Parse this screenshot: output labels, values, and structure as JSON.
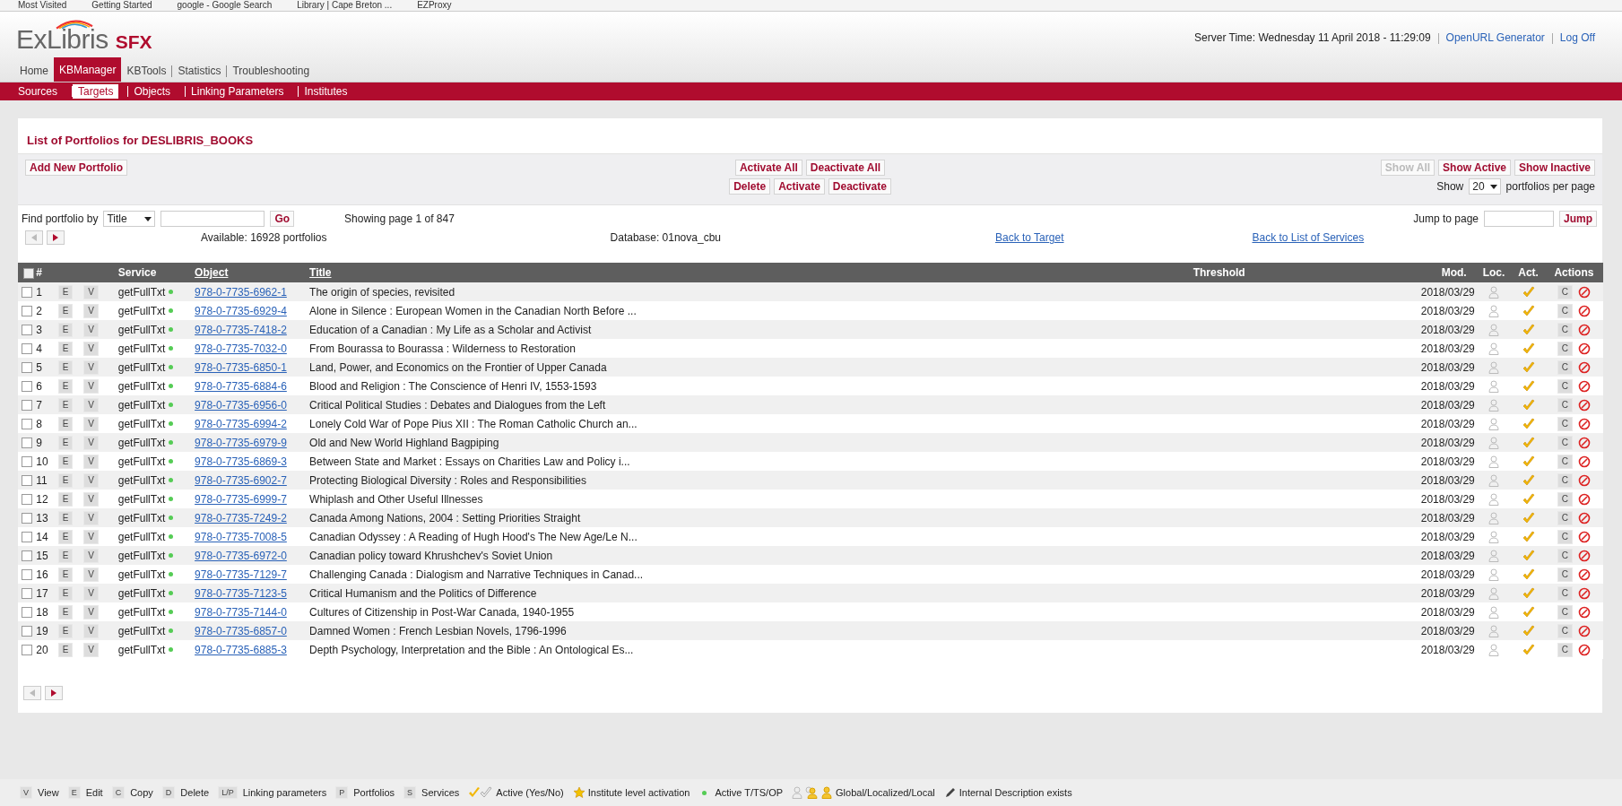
{
  "bookmarks": [
    "Most Visited",
    "Getting Started",
    "google - Google Search",
    "Library | Cape Breton ...",
    "EZProxy"
  ],
  "header": {
    "logo_main": "ExLibris",
    "logo_sub": "SFX",
    "server_time": "Server Time: Wednesday 11 April 2018 - 11:29:09",
    "links": [
      "OpenURL Generator",
      "Log Off"
    ]
  },
  "nav": [
    {
      "label": "Home",
      "selected": false
    },
    {
      "label": "KBManager",
      "selected": true
    },
    {
      "label": "KBTools",
      "selected": false
    },
    {
      "label": "Statistics",
      "selected": false
    },
    {
      "label": "Troubleshooting",
      "selected": false
    }
  ],
  "subnav": [
    {
      "label": "Sources",
      "selected": false
    },
    {
      "label": "Targets",
      "selected": true
    },
    {
      "label": "Objects",
      "selected": false
    },
    {
      "label": "Linking Parameters",
      "selected": false
    },
    {
      "label": "Institutes",
      "selected": false
    }
  ],
  "page_title": "List of Portfolios for DESLIBRIS_BOOKS",
  "toolbar": {
    "add": "Add New Portfolio",
    "center_top": [
      "Activate All",
      "Deactivate All"
    ],
    "center_bottom": [
      "Delete",
      "Activate",
      "Deactivate"
    ],
    "filters": [
      {
        "label": "Show All",
        "disabled": true
      },
      {
        "label": "Show Active",
        "disabled": false
      },
      {
        "label": "Show Inactive",
        "disabled": false
      }
    ],
    "show_label": "Show",
    "per_page": "20",
    "per_page_suffix": "portfolios per page"
  },
  "find": {
    "label": "Find portfolio by",
    "field": "Title",
    "button": "Go",
    "showing": "Showing page 1 of 847",
    "jump_label": "Jump to page",
    "jump_button": "Jump",
    "available": "Available: 16928 portfolios",
    "database": "Database: 01nova_cbu",
    "back_target": "Back to Target",
    "back_services": "Back to List of Services"
  },
  "table": {
    "columns": [
      "#",
      "Service",
      "Object",
      "Title",
      "Threshold",
      "Mod.",
      "Loc.",
      "Act.",
      "Actions"
    ],
    "select_all_checked": false,
    "rows": [
      {
        "num": "1",
        "service": "getFullTxt",
        "object": "978-0-7735-6962-1",
        "title": "The origin of species, revisited",
        "mod": "2018/03/29",
        "checked": false,
        "edit": "E",
        "view": "V",
        "copy": "C"
      },
      {
        "num": "2",
        "service": "getFullTxt",
        "object": "978-0-7735-6929-4",
        "title": "Alone in Silence : European Women in the Canadian North Before ...",
        "mod": "2018/03/29",
        "checked": false,
        "edit": "E",
        "view": "V",
        "copy": "C"
      },
      {
        "num": "3",
        "service": "getFullTxt",
        "object": "978-0-7735-7418-2",
        "title": "Education of a Canadian : My Life as a Scholar and Activist",
        "mod": "2018/03/29",
        "checked": false,
        "edit": "E",
        "view": "V",
        "copy": "C"
      },
      {
        "num": "4",
        "service": "getFullTxt",
        "object": "978-0-7735-7032-0",
        "title": "From Bourassa to Bourassa : Wilderness to Restoration",
        "mod": "2018/03/29",
        "checked": false,
        "edit": "E",
        "view": "V",
        "copy": "C"
      },
      {
        "num": "5",
        "service": "getFullTxt",
        "object": "978-0-7735-6850-1",
        "title": "Land, Power, and Economics on the Frontier of Upper Canada",
        "mod": "2018/03/29",
        "checked": false,
        "edit": "E",
        "view": "V",
        "copy": "C"
      },
      {
        "num": "6",
        "service": "getFullTxt",
        "object": "978-0-7735-6884-6",
        "title": "Blood and Religion : The Conscience of Henri IV, 1553-1593",
        "mod": "2018/03/29",
        "checked": false,
        "edit": "E",
        "view": "V",
        "copy": "C"
      },
      {
        "num": "7",
        "service": "getFullTxt",
        "object": "978-0-7735-6956-0",
        "title": "Critical Political Studies : Debates and Dialogues from the Left",
        "mod": "2018/03/29",
        "checked": false,
        "edit": "E",
        "view": "V",
        "copy": "C"
      },
      {
        "num": "8",
        "service": "getFullTxt",
        "object": "978-0-7735-6994-2",
        "title": "Lonely Cold War of Pope Pius XII : The Roman Catholic Church an...",
        "mod": "2018/03/29",
        "checked": false,
        "edit": "E",
        "view": "V",
        "copy": "C"
      },
      {
        "num": "9",
        "service": "getFullTxt",
        "object": "978-0-7735-6979-9",
        "title": "Old and New World Highland Bagpiping",
        "mod": "2018/03/29",
        "checked": false,
        "edit": "E",
        "view": "V",
        "copy": "C"
      },
      {
        "num": "10",
        "service": "getFullTxt",
        "object": "978-0-7735-6869-3",
        "title": "Between State and Market : Essays on Charities Law and Policy i...",
        "mod": "2018/03/29",
        "checked": false,
        "edit": "E",
        "view": "V",
        "copy": "C"
      },
      {
        "num": "11",
        "service": "getFullTxt",
        "object": "978-0-7735-6902-7",
        "title": "Protecting Biological Diversity : Roles and Responsibilities",
        "mod": "2018/03/29",
        "checked": false,
        "edit": "E",
        "view": "V",
        "copy": "C"
      },
      {
        "num": "12",
        "service": "getFullTxt",
        "object": "978-0-7735-6999-7",
        "title": "Whiplash and Other Useful Illnesses",
        "mod": "2018/03/29",
        "checked": false,
        "edit": "E",
        "view": "V",
        "copy": "C"
      },
      {
        "num": "13",
        "service": "getFullTxt",
        "object": "978-0-7735-7249-2",
        "title": "Canada Among Nations, 2004 : Setting Priorities Straight",
        "mod": "2018/03/29",
        "checked": false,
        "edit": "E",
        "view": "V",
        "copy": "C"
      },
      {
        "num": "14",
        "service": "getFullTxt",
        "object": "978-0-7735-7008-5",
        "title": "Canadian Odyssey : A Reading of Hugh Hood's The New Age/Le N...",
        "mod": "2018/03/29",
        "checked": false,
        "edit": "E",
        "view": "V",
        "copy": "C"
      },
      {
        "num": "15",
        "service": "getFullTxt",
        "object": "978-0-7735-6972-0",
        "title": "Canadian policy toward Khrushchev's Soviet Union",
        "mod": "2018/03/29",
        "checked": false,
        "edit": "E",
        "view": "V",
        "copy": "C"
      },
      {
        "num": "16",
        "service": "getFullTxt",
        "object": "978-0-7735-7129-7",
        "title": "Challenging Canada : Dialogism and Narrative Techniques in Canad...",
        "mod": "2018/03/29",
        "checked": false,
        "edit": "E",
        "view": "V",
        "copy": "C"
      },
      {
        "num": "17",
        "service": "getFullTxt",
        "object": "978-0-7735-7123-5",
        "title": "Critical Humanism and the Politics of Difference",
        "mod": "2018/03/29",
        "checked": false,
        "edit": "E",
        "view": "V",
        "copy": "C"
      },
      {
        "num": "18",
        "service": "getFullTxt",
        "object": "978-0-7735-7144-0",
        "title": "Cultures of Citizenship in Post-War Canada, 1940-1955",
        "mod": "2018/03/29",
        "checked": false,
        "edit": "E",
        "view": "V",
        "copy": "C"
      },
      {
        "num": "19",
        "service": "getFullTxt",
        "object": "978-0-7735-6857-0",
        "title": "Damned Women : French Lesbian Novels, 1796-1996",
        "mod": "2018/03/29",
        "checked": false,
        "edit": "E",
        "view": "V",
        "copy": "C"
      },
      {
        "num": "20",
        "service": "getFullTxt",
        "object": "978-0-7735-6885-3",
        "title": "Depth Psychology, Interpretation and the Bible : An Ontological Es...",
        "mod": "2018/03/29",
        "checked": false,
        "edit": "E",
        "view": "V",
        "copy": "C"
      }
    ]
  },
  "legend": [
    {
      "kind": "key",
      "key": "V",
      "label": "View"
    },
    {
      "kind": "key",
      "key": "E",
      "label": "Edit"
    },
    {
      "kind": "key",
      "key": "C",
      "label": "Copy"
    },
    {
      "kind": "key",
      "key": "D",
      "label": "Delete"
    },
    {
      "kind": "key",
      "key": "L/P",
      "label": "Linking parameters"
    },
    {
      "kind": "key",
      "key": "P",
      "label": "Portfolios"
    },
    {
      "kind": "key",
      "key": "S",
      "label": "Services"
    },
    {
      "kind": "checks",
      "label": "Active (Yes/No)"
    },
    {
      "kind": "star",
      "label": "Institute level activation"
    },
    {
      "kind": "dot",
      "label": "Active T/TS/OP"
    },
    {
      "kind": "persons",
      "label": "Global/Localized/Local"
    },
    {
      "kind": "pencil",
      "label": "Internal Description exists"
    }
  ]
}
